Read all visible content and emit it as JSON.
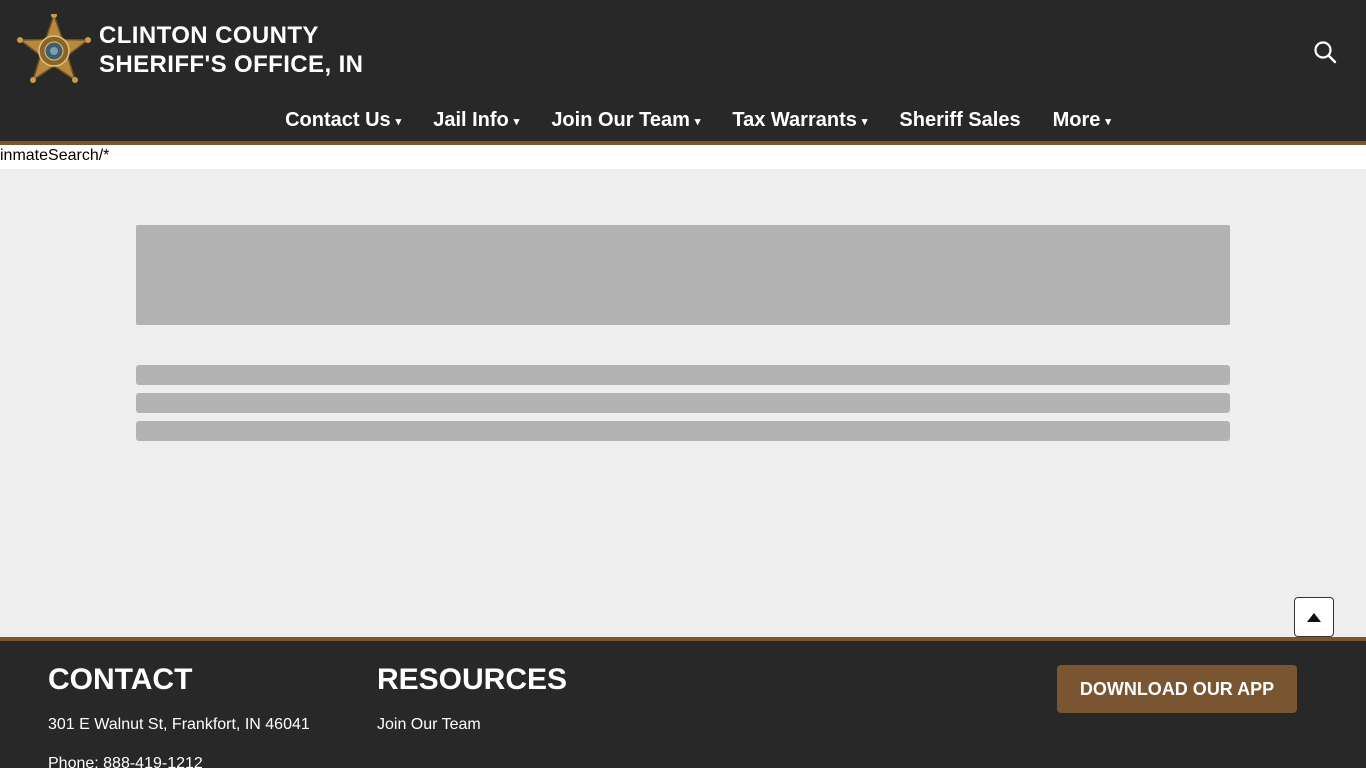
{
  "header": {
    "title_line1": "CLINTON COUNTY",
    "title_line2": "SHERIFF'S OFFICE, IN",
    "logo_icon": "sheriff-star-badge",
    "search_icon": "search-icon"
  },
  "nav": {
    "items": [
      {
        "label": "Contact Us",
        "has_dropdown": true
      },
      {
        "label": "Jail Info",
        "has_dropdown": true
      },
      {
        "label": "Join Our Team",
        "has_dropdown": true
      },
      {
        "label": "Tax Warrants",
        "has_dropdown": true
      },
      {
        "label": "Sheriff Sales",
        "has_dropdown": false
      },
      {
        "label": "More",
        "has_dropdown": true
      }
    ],
    "caret": "▾"
  },
  "url_strip": {
    "text": "inmateSearch/*"
  },
  "footer": {
    "contact_heading": "CONTACT",
    "address": "301 E Walnut St, Frankfort, IN 46041",
    "phone": "Phone: 888-419-1212",
    "resources_heading": "RESOURCES",
    "resources_links": [
      "Join Our Team"
    ],
    "app_button": "DOWNLOAD OUR APP"
  },
  "colors": {
    "header_bg": "#282828",
    "accent_brown": "#7a5532",
    "content_bg": "#eeeeee",
    "skeleton": "#b3b3b3"
  }
}
